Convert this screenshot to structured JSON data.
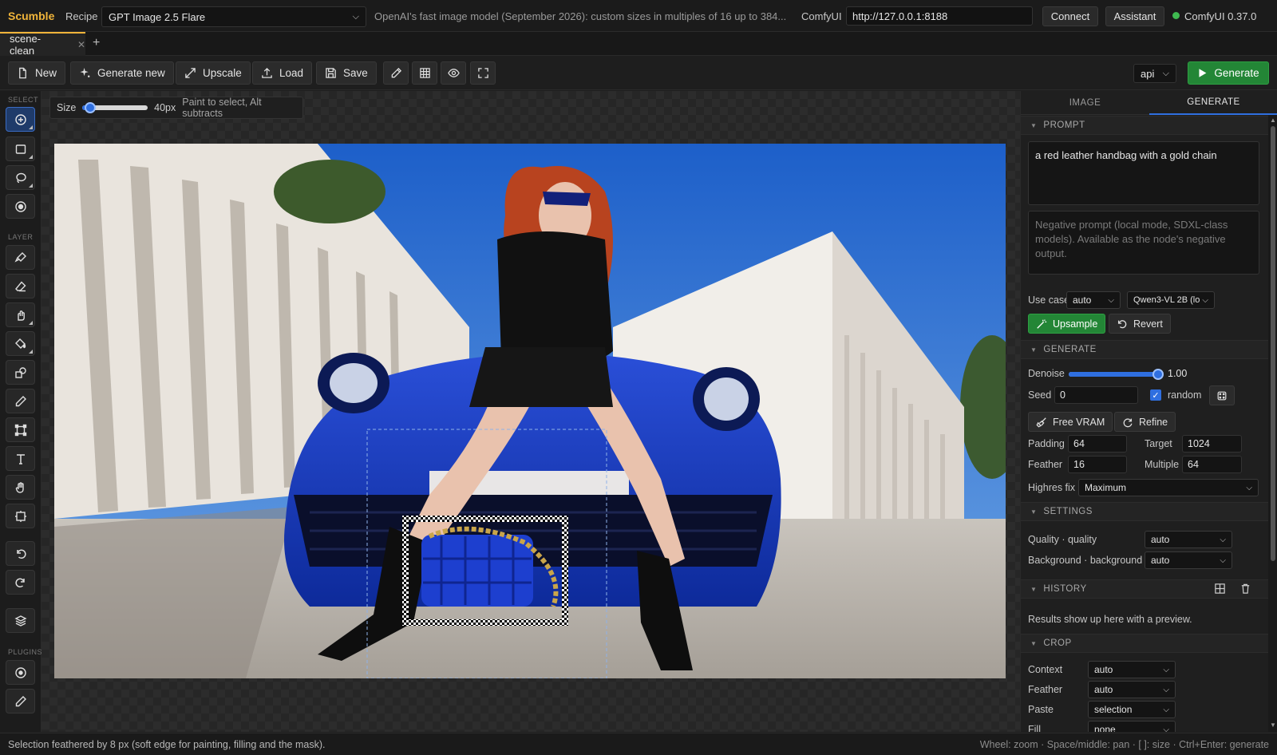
{
  "header": {
    "brand": "Scumble",
    "recipe_label": "Recipe",
    "recipe_value": "GPT Image 2.5 Flare",
    "model_description": "OpenAI's fast image model (September 2026): custom sizes in multiples of 16 up to 384...",
    "comfy_label": "ComfyUI",
    "comfy_url": "http://127.0.0.1:8188",
    "connect_label": "Connect",
    "assistant_label": "Assistant",
    "status_text": "ComfyUI 0.37.0",
    "status_color": "#3fb950"
  },
  "tabs": [
    {
      "label": "scene-clean"
    }
  ],
  "toolbar": {
    "new_label": "New",
    "generate_new_label": "Generate new",
    "upscale_label": "Upscale",
    "load_label": "Load",
    "save_label": "Save",
    "mode_value": "api",
    "generate_label": "Generate"
  },
  "toolrail": {
    "select_heading": "SELECT",
    "layer_heading": "LAYER",
    "plugins_heading": "PLUGINS"
  },
  "size_tool": {
    "label": "Size",
    "value": "40px",
    "hint": "Paint to select, Alt subtracts",
    "slider_fraction": 0.12
  },
  "panel": {
    "tab_image": "IMAGE",
    "tab_generate": "GENERATE",
    "prompt_heading": "PROMPT",
    "prompt_value": "a red leather handbag with a gold chain",
    "negative_placeholder": "Negative prompt (local mode, SDXL-class models). Available as the node's negative output.",
    "use_case_label": "Use case",
    "use_case_value": "auto",
    "vl_model_value": "Qwen3-VL 2B (lo",
    "upsample_label": "Upsample",
    "revert_label": "Revert",
    "generate_heading": "GENERATE",
    "denoise_label": "Denoise",
    "denoise_value": "1.00",
    "denoise_fraction": 1.0,
    "seed_label": "Seed",
    "seed_value": "0",
    "random_label": "random",
    "free_vram_label": "Free VRAM",
    "refine_label": "Refine",
    "padding_label": "Padding",
    "padding_value": "64",
    "target_label": "Target",
    "target_value": "1024",
    "feather_label": "Feather",
    "feather_value": "16",
    "multiple_label": "Multiple",
    "multiple_value": "64",
    "highres_label": "Highres fix",
    "highres_value": "Maximum",
    "settings_heading": "SETTINGS",
    "quality_label": "Quality · quality",
    "quality_value": "auto",
    "background_label": "Background · background",
    "background_value": "auto",
    "history_heading": "HISTORY",
    "history_hint": "Results show up here with a preview.",
    "crop_heading": "CROP",
    "context_label": "Context",
    "context_value": "auto",
    "crop_feather_label": "Feather",
    "crop_feather_value": "auto",
    "paste_label": "Paste",
    "paste_value": "selection",
    "fill_label": "Fill",
    "fill_value": "none"
  },
  "statusbar": {
    "left": "Selection feathered by 8 px (soft edge for painting, filling and the mask).",
    "right": "Wheel: zoom · Space/middle: pan · [ ]: size · Ctrl+Enter: generate"
  },
  "colors": {
    "accent": "#2f6fe0",
    "brand": "#f0b43a",
    "success": "#238636"
  }
}
